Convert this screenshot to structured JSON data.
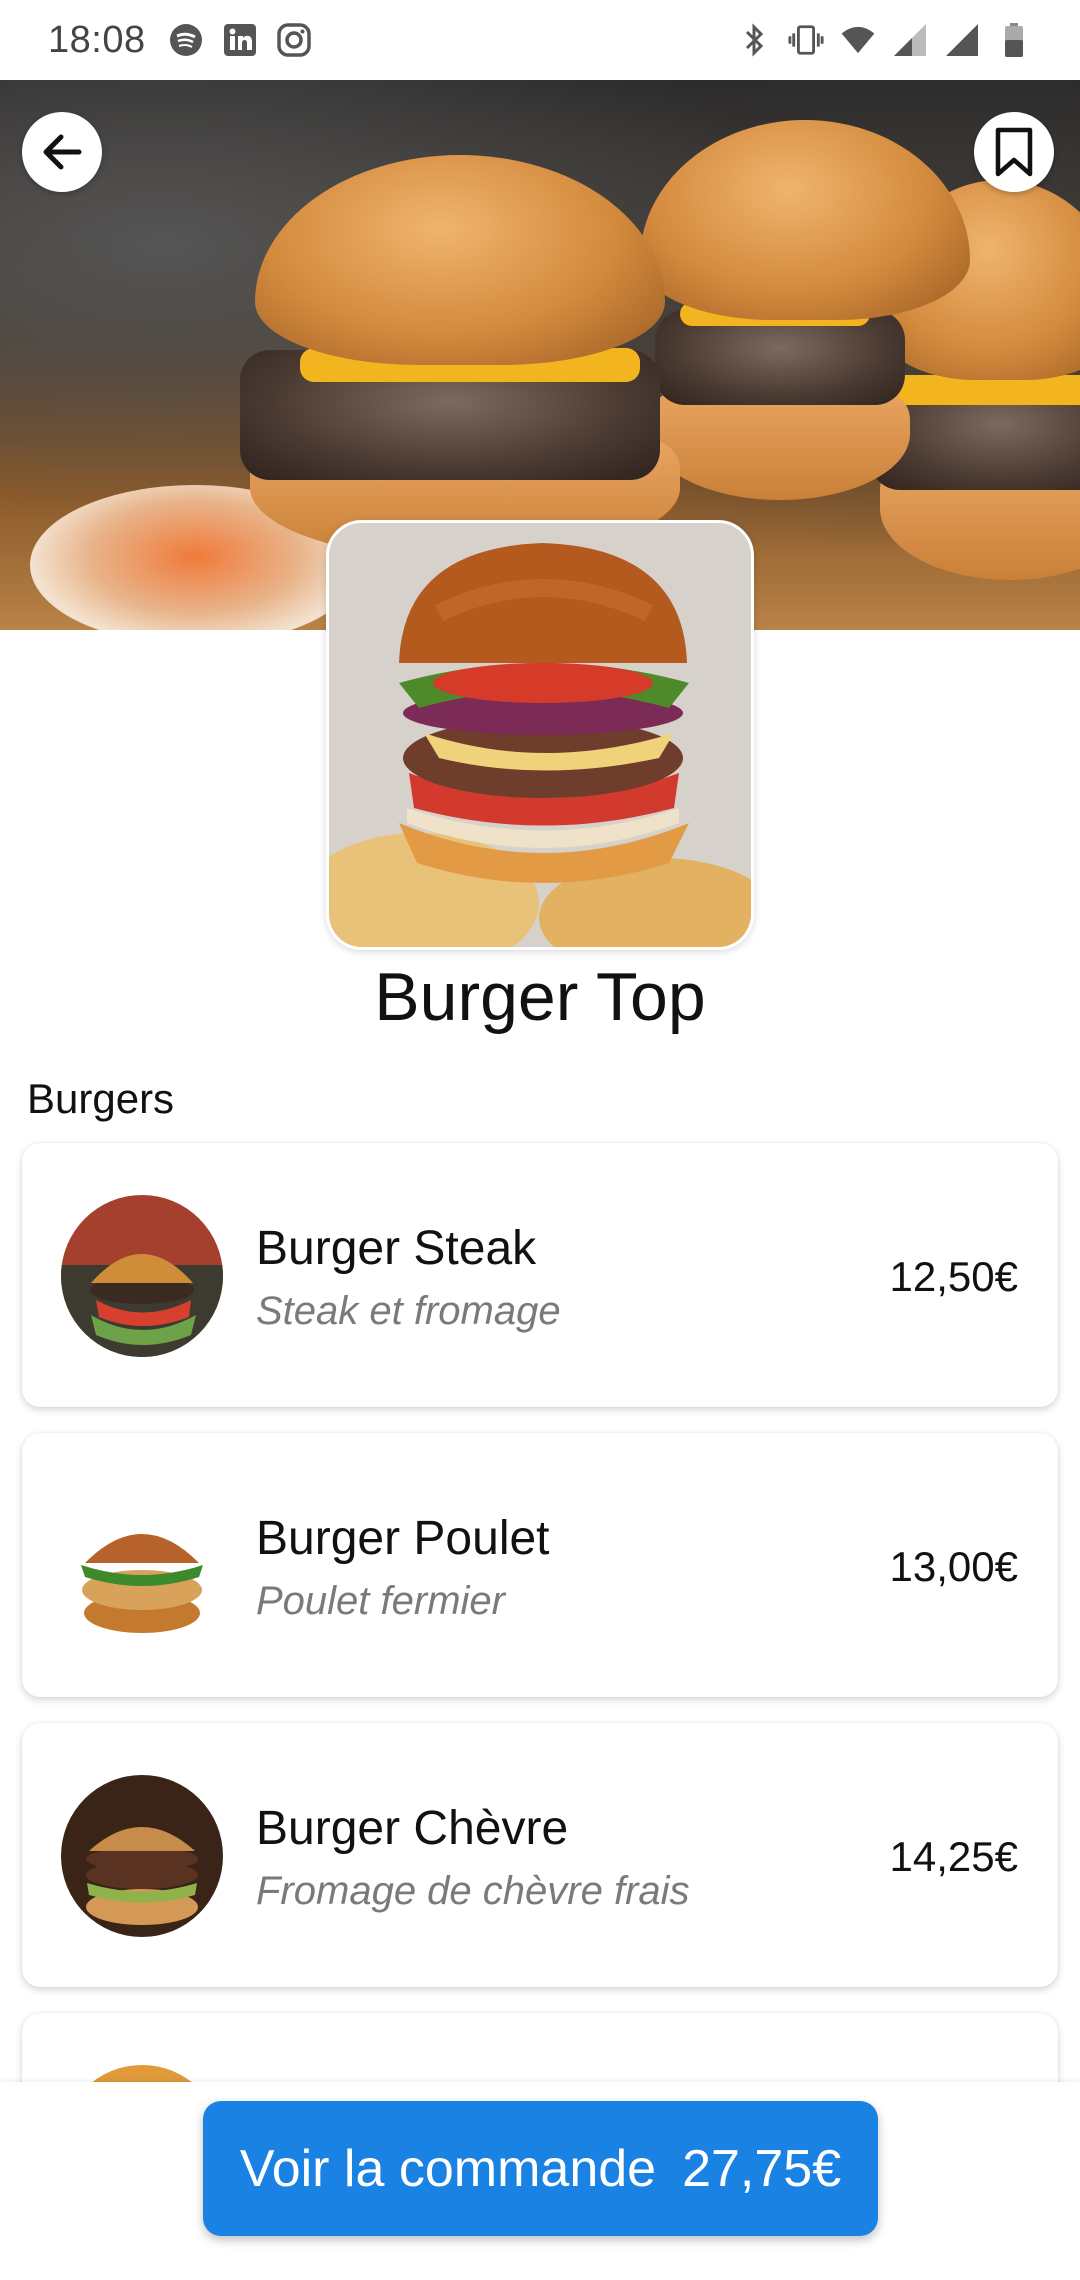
{
  "status_bar": {
    "time": "18:08",
    "left_icons": [
      "spotify-icon",
      "linkedin-icon",
      "instagram-icon"
    ],
    "right_icons": [
      "bluetooth-icon",
      "vibrate-icon",
      "wifi-icon",
      "signal-icon",
      "signal-icon",
      "battery-icon"
    ]
  },
  "header": {
    "back_icon": "arrow-left-icon",
    "bookmark_icon": "bookmark-icon"
  },
  "restaurant": {
    "name": "Burger Top"
  },
  "section": {
    "title": "Burgers"
  },
  "products": [
    {
      "name": "Burger Steak",
      "description": "Steak et fromage",
      "price": "12,50€"
    },
    {
      "name": "Burger Poulet",
      "description": "Poulet fermier",
      "price": "13,00€"
    },
    {
      "name": "Burger Chèvre",
      "description": "Fromage de chèvre frais",
      "price": "14,25€"
    }
  ],
  "order": {
    "label": "Voir la commande",
    "total": "27,75€"
  },
  "colors": {
    "accent": "#1a82e2",
    "description_text": "#7a7a7a"
  }
}
